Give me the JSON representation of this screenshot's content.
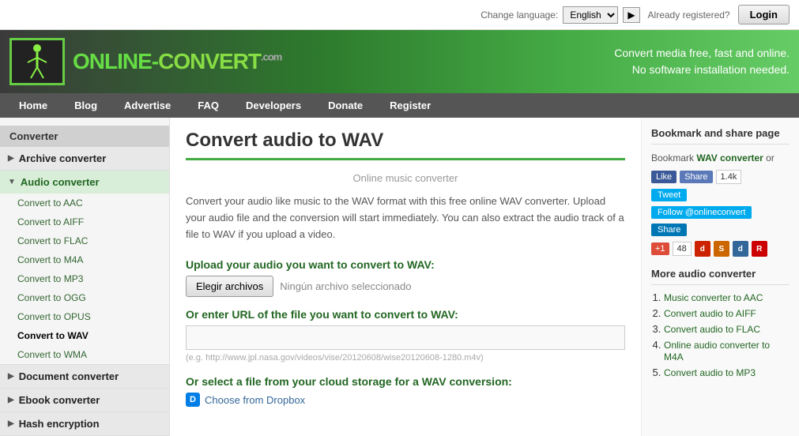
{
  "topbar": {
    "lang_label": "Change language:",
    "lang_selected": "English",
    "lang_arrow": "▶",
    "already": "Already registered?",
    "login_label": "Login"
  },
  "header": {
    "logo_text1": "ONLINE-",
    "logo_text2": "CONVERT",
    "logo_com": ".com",
    "tagline1": "Convert media free, fast and online.",
    "tagline2": "No software installation needed."
  },
  "nav": {
    "items": [
      {
        "label": "Home",
        "active": false
      },
      {
        "label": "Blog",
        "active": false
      },
      {
        "label": "Advertise",
        "active": false
      },
      {
        "label": "FAQ",
        "active": false
      },
      {
        "label": "Developers",
        "active": false
      },
      {
        "label": "Donate",
        "active": false
      },
      {
        "label": "Register",
        "active": false
      }
    ]
  },
  "sidebar": {
    "title": "Converter",
    "groups": [
      {
        "label": "Archive converter",
        "open": false,
        "icon": "▶",
        "items": []
      },
      {
        "label": "Audio converter",
        "open": true,
        "icon": "▼",
        "items": [
          {
            "label": "Convert to AAC",
            "active": false
          },
          {
            "label": "Convert to AIFF",
            "active": false
          },
          {
            "label": "Convert to FLAC",
            "active": false
          },
          {
            "label": "Convert to M4A",
            "active": false
          },
          {
            "label": "Convert to MP3",
            "active": false
          },
          {
            "label": "Convert to OGG",
            "active": false
          },
          {
            "label": "Convert to OPUS",
            "active": false
          },
          {
            "label": "Convert to WAV",
            "active": true
          },
          {
            "label": "Convert to WMA",
            "active": false
          }
        ]
      },
      {
        "label": "Document converter",
        "open": false,
        "icon": "▶",
        "items": []
      },
      {
        "label": "Ebook converter",
        "open": false,
        "icon": "▶",
        "items": []
      },
      {
        "label": "Hash encryption",
        "open": false,
        "icon": "▶",
        "items": []
      }
    ]
  },
  "main": {
    "page_title": "Convert audio to WAV",
    "subtitle": "Online music converter",
    "description": "Convert your audio like music to the WAV format with this free online WAV converter. Upload your audio file and the conversion will start immediately. You can also extract the audio track of a file to WAV if you upload a video.",
    "upload_label": "Upload your audio you want to convert to WAV:",
    "choose_btn": "Elegir archivos",
    "no_file": "Ningún archivo seleccionado",
    "url_label": "Or enter URL of the file you want to convert to WAV:",
    "url_placeholder": "",
    "url_hint": "(e.g. http://www.jpl.nasa.gov/videos/vise/20120608/wise20120608-1280.m4v)",
    "cloud_label": "Or select a file from your cloud storage for a WAV conversion:",
    "dropbox_btn": "Choose from Dropbox"
  },
  "right_sidebar": {
    "bookmark_title": "Bookmark and share page",
    "bookmark_text": "Bookmark ",
    "bookmark_link": "WAV converter",
    "bookmark_or": " or",
    "fb_like": "Like",
    "fb_share": "Share",
    "fb_count": "1.4k",
    "tweet": "Tweet",
    "follow": "Follow @onlineconvert",
    "linkedin_share": "Share",
    "gplus": "+1",
    "gplus_count": "48",
    "more_title": "More audio converter",
    "more_items": [
      {
        "label": "Music converter to AAC"
      },
      {
        "label": "Convert audio to AIFF"
      },
      {
        "label": "Convert audio to FLAC"
      },
      {
        "label": "Online audio converter to M4A"
      },
      {
        "label": "Convert audio to MP3"
      }
    ]
  }
}
